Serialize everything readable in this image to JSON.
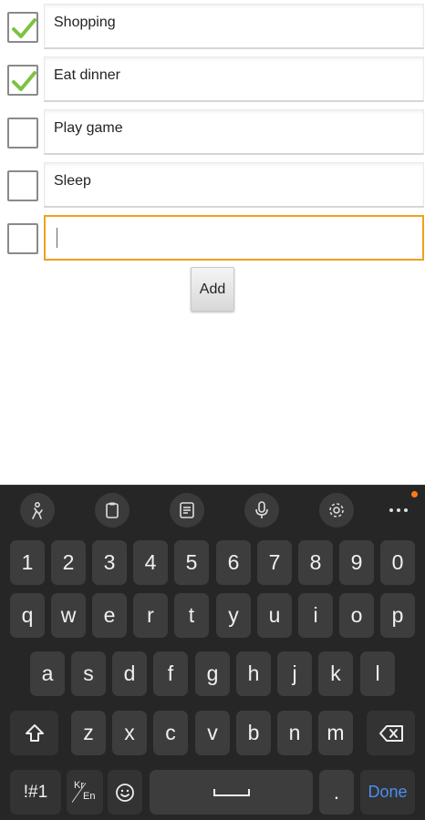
{
  "todo": {
    "items": [
      {
        "label": "Shopping",
        "checked": true
      },
      {
        "label": "Eat dinner",
        "checked": true
      },
      {
        "label": "Play game",
        "checked": false
      },
      {
        "label": "Sleep",
        "checked": false
      }
    ],
    "new_item": {
      "value": "",
      "checked": false
    },
    "add_label": "Add"
  },
  "keyboard": {
    "toolbar": [
      "sticker-icon",
      "clipboard-icon",
      "keyboard-mode-icon",
      "microphone-icon",
      "settings-icon",
      "more-icon"
    ],
    "numbers": [
      "1",
      "2",
      "3",
      "4",
      "5",
      "6",
      "7",
      "8",
      "9",
      "0"
    ],
    "row1": [
      "q",
      "w",
      "e",
      "r",
      "t",
      "y",
      "u",
      "i",
      "o",
      "p"
    ],
    "row2": [
      "a",
      "s",
      "d",
      "f",
      "g",
      "h",
      "j",
      "k",
      "l"
    ],
    "row3": [
      "z",
      "x",
      "c",
      "v",
      "b",
      "n",
      "m"
    ],
    "symbols_label": "!#1",
    "lang_top": "Kr",
    "lang_bottom": "En",
    "period_label": ".",
    "done_label": "Done",
    "accent_color": "#f0a020",
    "done_color": "#4a8ff0"
  }
}
